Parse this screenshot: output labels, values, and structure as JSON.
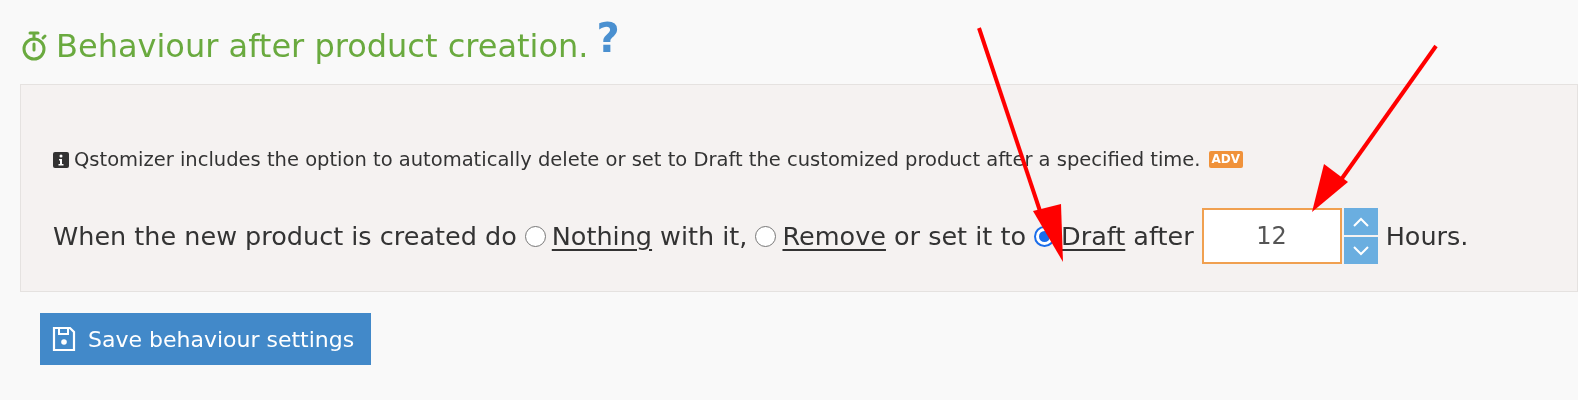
{
  "heading": {
    "title": "Behaviour after product creation.",
    "help": "?"
  },
  "info": {
    "text": "Qstomizer includes the option to automatically delete or set to Draft the customized product after a specified time.",
    "badge": "ADV"
  },
  "sentence": [
    {
      "kind": "text",
      "text": "When the new product is created do"
    },
    {
      "kind": "radio",
      "label": "Nothing",
      "selected": false
    },
    {
      "kind": "text",
      "text": "with it,"
    },
    {
      "kind": "radio",
      "label": "Remove",
      "selected": false
    },
    {
      "kind": "text",
      "text": "or set it to"
    },
    {
      "kind": "radio",
      "label": "Draft",
      "selected": true
    },
    {
      "kind": "text",
      "text": "after"
    },
    {
      "kind": "number",
      "value": "12"
    },
    {
      "kind": "text",
      "text": "Hours."
    }
  ],
  "save_button": "Save behaviour settings"
}
